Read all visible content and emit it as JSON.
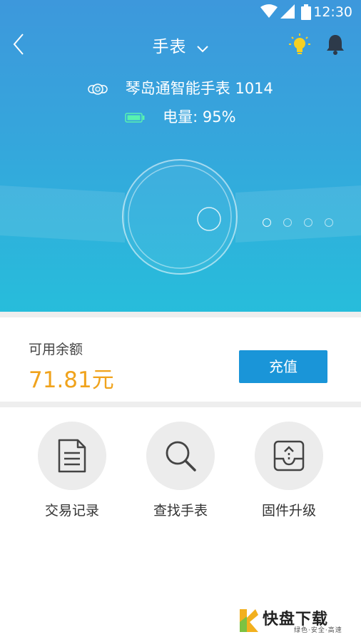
{
  "status_bar": {
    "time": "12:30"
  },
  "header": {
    "title": "手表"
  },
  "device": {
    "name": "琴岛通智能手表 1014",
    "battery": "电量: 95%"
  },
  "balance": {
    "label": "可用余额",
    "amount": "71.81元",
    "recharge_label": "充值"
  },
  "actions": [
    {
      "label": "交易记录",
      "icon": "document-icon"
    },
    {
      "label": "查找手表",
      "icon": "search-icon"
    },
    {
      "label": "固件升级",
      "icon": "upgrade-tray-icon"
    }
  ],
  "carousel": {
    "total": 4,
    "active": 0
  },
  "watermark": {
    "logo_text": "快盘下载",
    "subtitle": "绿色·安全·高速"
  },
  "colors": {
    "hero_top": "#3d98dc",
    "hero_bottom": "#27bddb",
    "accent": "#1a95d8",
    "amount": "#f0a31c",
    "bulb": "#f6d022"
  }
}
